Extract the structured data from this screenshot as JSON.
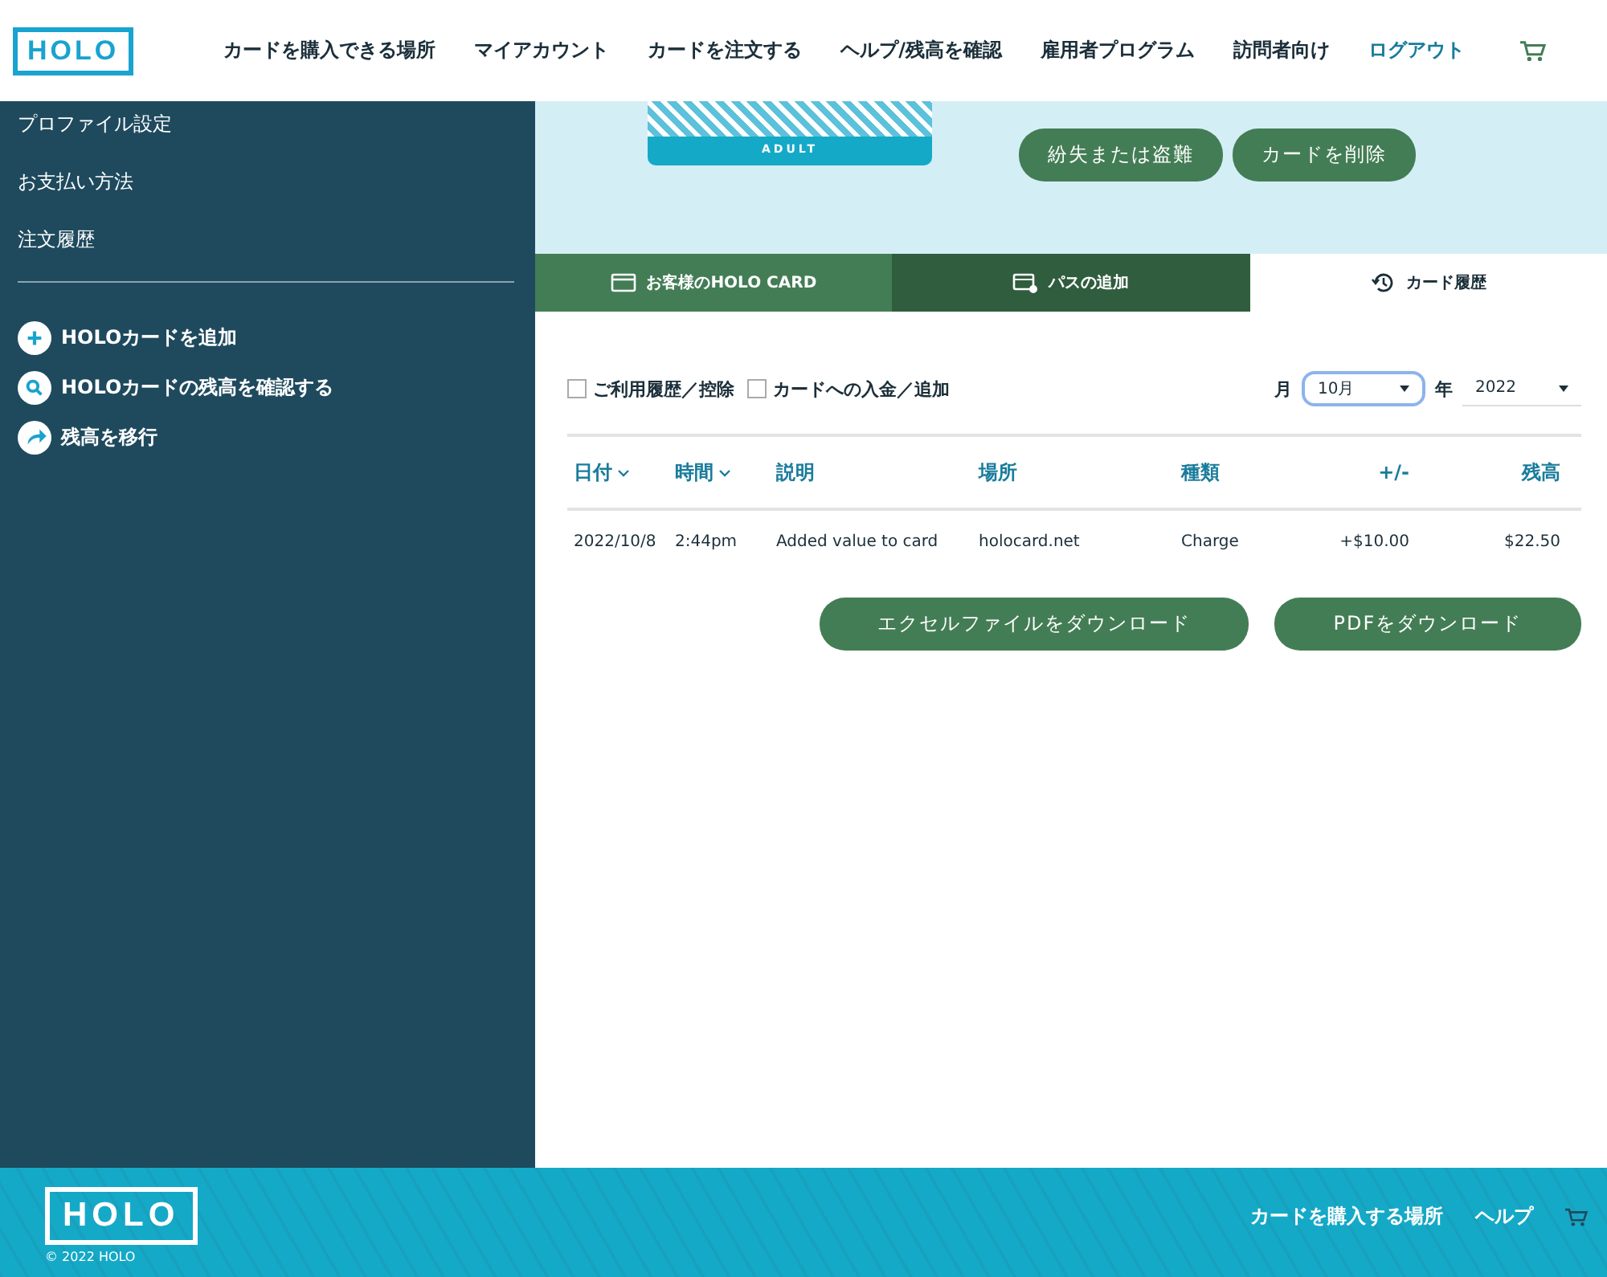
{
  "header": {
    "logo": "HOLO",
    "nav": [
      {
        "label": "カードを購入できる場所",
        "kind": "link"
      },
      {
        "label": "マイアカウント",
        "kind": "link"
      },
      {
        "label": "カードを注文する",
        "kind": "link"
      },
      {
        "label": "ヘルプ/残高を確認",
        "kind": "link"
      },
      {
        "label": "雇用者プログラム",
        "kind": "link"
      },
      {
        "label": "訪問者向け",
        "kind": "link"
      },
      {
        "label": "ログアウト",
        "kind": "accent"
      }
    ]
  },
  "sidebar": {
    "items": [
      "プロファイル設定",
      "お支払い方法",
      "注文履歴"
    ],
    "actions": [
      {
        "label": "HOLOカードを追加",
        "kind": "plus"
      },
      {
        "label": "HOLOカードの残高を確認する",
        "kind": "search"
      },
      {
        "label": "残高を移行",
        "kind": "share"
      }
    ]
  },
  "card_panel": {
    "card_label": "ADULT",
    "buttons": [
      "紛失または盗難",
      "カードを削除"
    ]
  },
  "tabs": [
    {
      "label": "お客様のHOLO CARD",
      "kind": "card",
      "selected": false
    },
    {
      "label": "パスの追加",
      "kind": "pass",
      "selected": false
    },
    {
      "label": "カード履歴",
      "kind": "history",
      "selected": true
    }
  ],
  "filters": {
    "checkboxes": [
      {
        "label": "ご利用履歴／控除",
        "checked": false
      },
      {
        "label": "カードへの入金／追加",
        "checked": false
      }
    ],
    "month_label": "月",
    "month": "10月",
    "year_label": "年",
    "year": "2022"
  },
  "table": {
    "columns": [
      {
        "label": "日付",
        "sortable": true
      },
      {
        "label": "時間",
        "sortable": true
      },
      {
        "label": "説明",
        "sortable": false
      },
      {
        "label": "場所",
        "sortable": false
      },
      {
        "label": "種類",
        "sortable": false
      },
      {
        "label": "+/-",
        "sortable": false
      },
      {
        "label": "残高",
        "sortable": false
      }
    ],
    "rows": [
      [
        "2022/10/8",
        "2:44pm",
        "Added value to card",
        "holocard.net",
        "Charge",
        "+$10.00",
        "$22.50"
      ]
    ]
  },
  "downloads": [
    "エクセルファイルをダウンロード",
    "PDFをダウンロード"
  ],
  "footer": {
    "logo": "HOLO",
    "links": [
      "カードを購入する場所",
      "ヘルプ"
    ],
    "copyright": "© 2022 HOLO"
  }
}
